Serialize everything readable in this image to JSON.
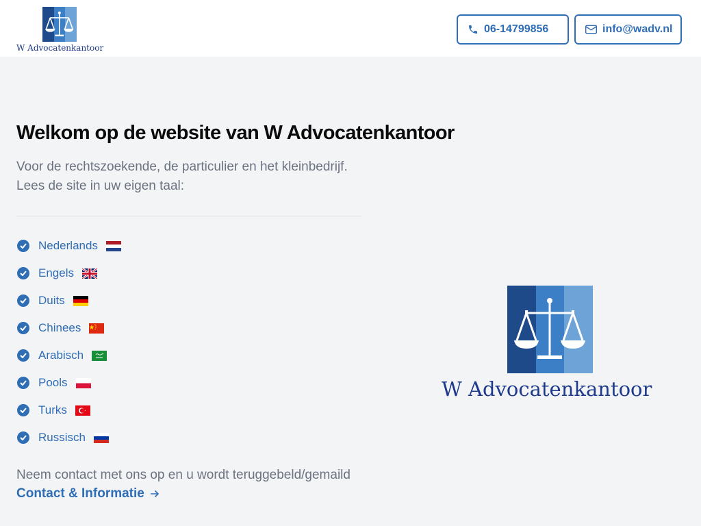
{
  "header": {
    "logo_text": "W Advocatenkantoor",
    "phone_label": "06-14799856",
    "email_label": "info@wadv.nl"
  },
  "main": {
    "title": "Welkom op de website van W Advocatenkantoor",
    "intro_line1": "Voor de rechtszoekende, de particulier en het kleinbedrijf.",
    "intro_line2": "Lees de site in uw eigen taal:",
    "languages": [
      {
        "label": "Nederlands",
        "flag": "flag-nl-icon"
      },
      {
        "label": "Engels",
        "flag": "flag-gb-icon"
      },
      {
        "label": "Duits",
        "flag": "flag-de-icon"
      },
      {
        "label": "Chinees",
        "flag": "flag-cn-icon"
      },
      {
        "label": "Arabisch",
        "flag": "flag-sa-icon"
      },
      {
        "label": "Pools",
        "flag": "flag-pl-icon"
      },
      {
        "label": "Turks",
        "flag": "flag-tr-icon"
      },
      {
        "label": "Russisch",
        "flag": "flag-ru-icon"
      }
    ],
    "contact_text": "Neem contact met ons op en u wordt teruggebeld/gemaild",
    "contact_link": "Contact & Informatie"
  },
  "logo_big": {
    "text": "W Advocatenkantoor"
  },
  "colors": {
    "accent": "#2f6db5",
    "logo_dark": "#1e4a8a",
    "logo_mid": "#3d7fc6",
    "logo_light": "#6ea3d8",
    "background": "#f3f4f6"
  }
}
